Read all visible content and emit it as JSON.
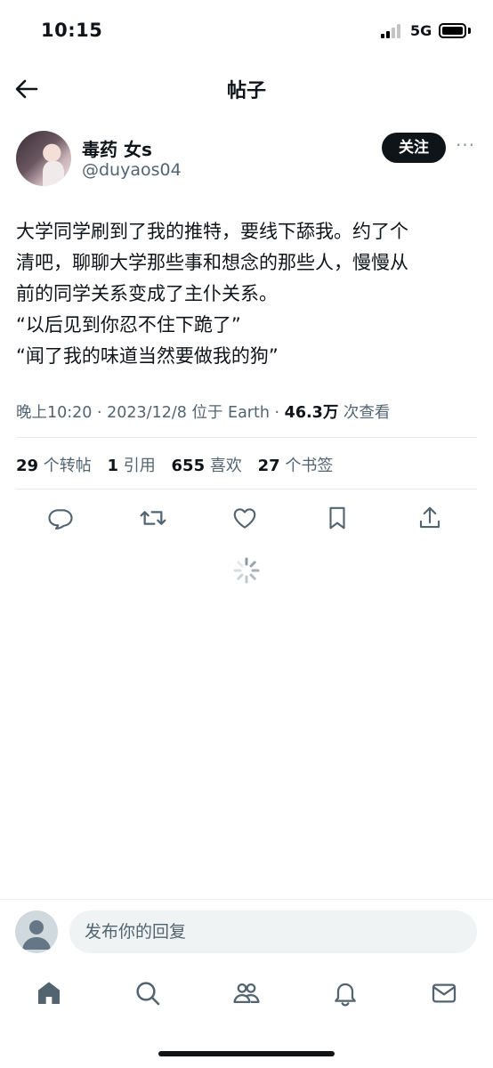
{
  "status_bar": {
    "time": "10:15",
    "network": "5G"
  },
  "nav": {
    "title": "帖子"
  },
  "author": {
    "display_name": "毒药 女s",
    "handle": "@duyaos04",
    "follow_label": "关注",
    "more_label": "···"
  },
  "tweet": {
    "lines": [
      "大学同学刷到了我的推特，要线下舔我。约了个",
      "清吧，聊聊大学那些事和想念的那些人，慢慢从",
      "前的同学关系变成了主仆关系。",
      "“以后见到你忍不住下跪了”",
      "“闻了我的味道当然要做我的狗”"
    ]
  },
  "meta": {
    "time": "晚上10:20",
    "date": "2023/12/8",
    "location": "位于 Earth",
    "views": "46.3万",
    "views_label": "次查看",
    "separator": " · "
  },
  "stats": {
    "retweets": {
      "num": "29",
      "label": "个转帖"
    },
    "quotes": {
      "num": "1",
      "label": "引用"
    },
    "likes": {
      "num": "655",
      "label": "喜欢"
    },
    "bookmarks": {
      "num": "27",
      "label": "个书签"
    }
  },
  "reply": {
    "placeholder": "发布你的回复"
  },
  "icons": {
    "back": "arrow-left-icon",
    "reply": "reply-icon",
    "retweet": "retweet-icon",
    "like": "heart-icon",
    "bookmark": "bookmark-icon",
    "share": "share-icon",
    "home": "home-icon",
    "search": "search-icon",
    "communities": "communities-icon",
    "notifications": "bell-icon",
    "messages": "mail-icon"
  },
  "colors": {
    "text": "#0f1419",
    "secondary": "#536471",
    "icon": "#536471",
    "button_bg": "#0f1419"
  }
}
